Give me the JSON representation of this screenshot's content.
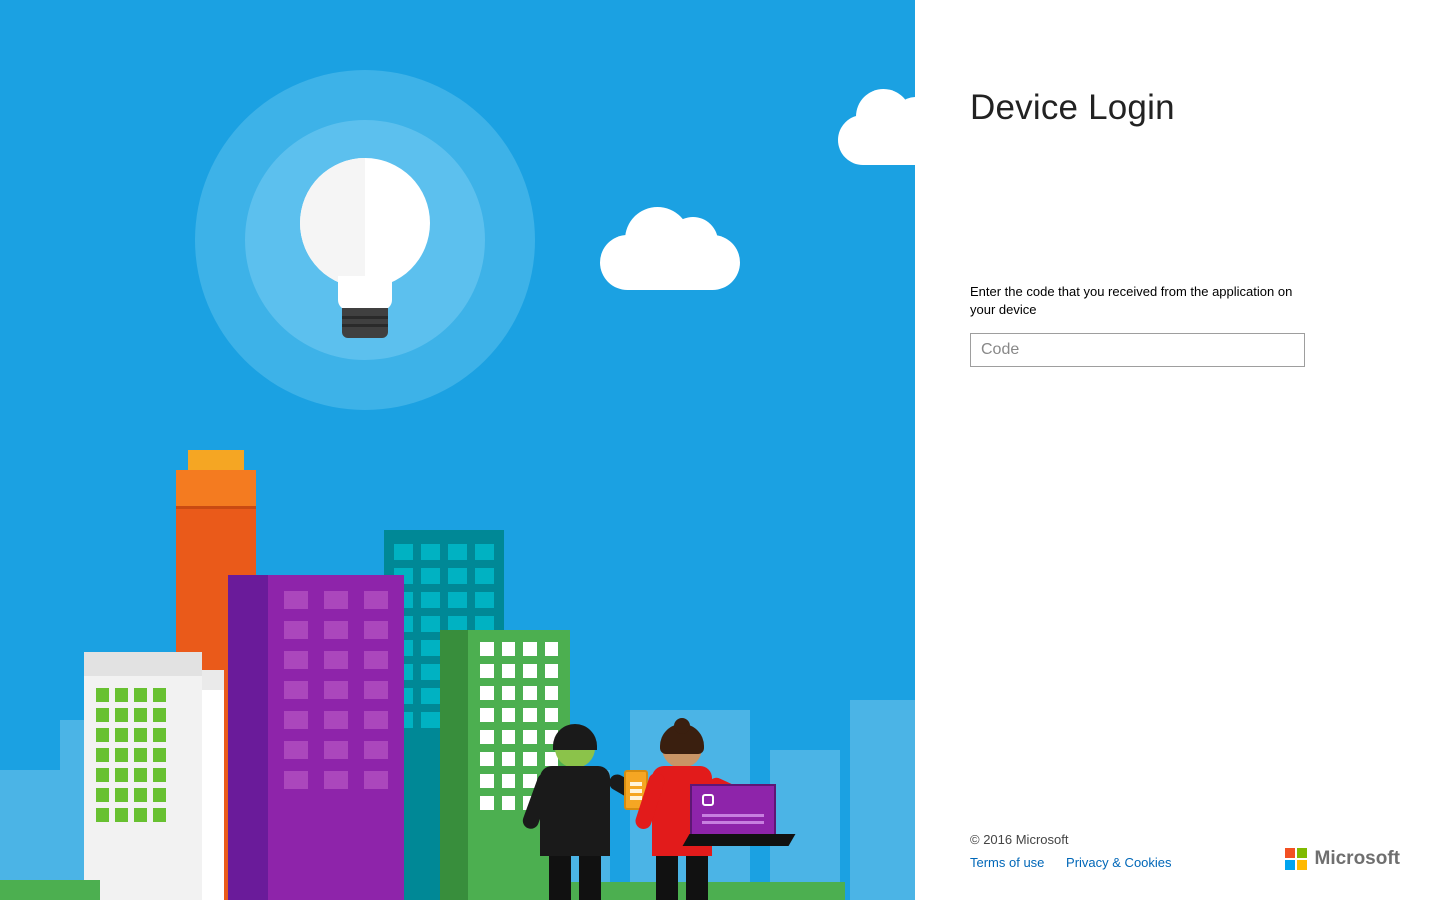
{
  "panel": {
    "title": "Device Login",
    "instruction": "Enter the code that you received from the application on your device",
    "code_placeholder": "Code"
  },
  "footer": {
    "copyright": "© 2016 Microsoft",
    "terms": "Terms of use",
    "privacy": "Privacy & Cookies",
    "brand": "Microsoft"
  }
}
